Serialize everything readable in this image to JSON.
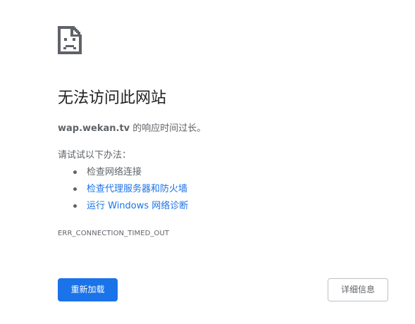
{
  "icon": "sad-page-icon",
  "title": "无法访问此网站",
  "subtitle": {
    "domain": "wap.wekan.tv",
    "message": " 的响应时间过长。"
  },
  "try_heading": "请试试以下办法：",
  "suggestions": [
    {
      "label": "检查网络连接",
      "is_link": false
    },
    {
      "label": "检查代理服务器和防火墙",
      "is_link": true
    },
    {
      "label": "运行 Windows 网络诊断",
      "is_link": true
    }
  ],
  "error_code": "ERR_CONNECTION_TIMED_OUT",
  "buttons": {
    "reload": "重新加载",
    "details": "详细信息"
  },
  "colors": {
    "accent": "#1a73e8",
    "text_primary": "#202124",
    "text_secondary": "#5f6368",
    "border": "#bdc1c6"
  }
}
